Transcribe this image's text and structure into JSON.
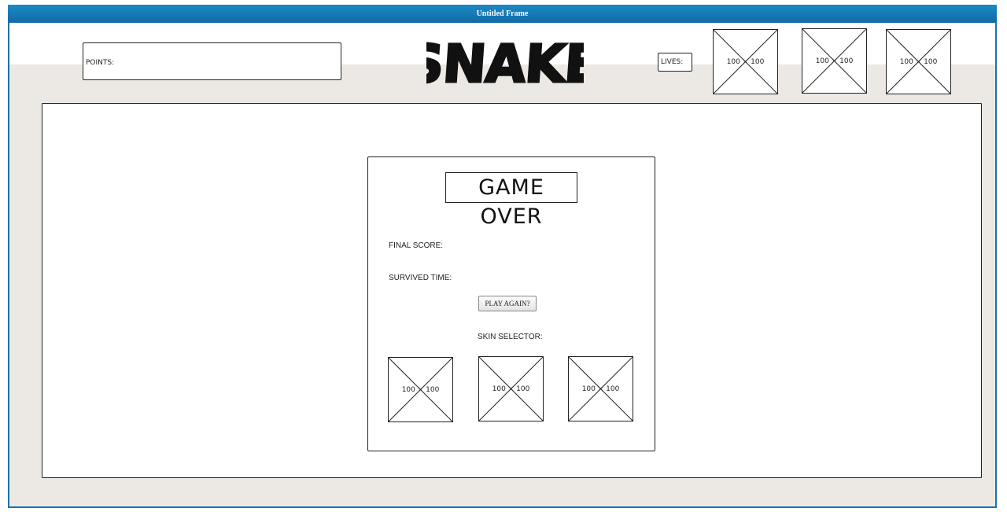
{
  "window": {
    "title": "Untitled Frame"
  },
  "header": {
    "points_label": "POINTS:",
    "logo_text": "SNAKE",
    "lives_label": "LIVES:",
    "lives_icons": [
      {
        "label": "100 × 100"
      },
      {
        "label": "100 × 100"
      },
      {
        "label": "100 × 100"
      }
    ]
  },
  "dialog": {
    "title": "GAME OVER",
    "final_score_label": "FINAL SCORE:",
    "survived_time_label": "SURVIVED TIME:",
    "play_again_label": "PLAY AGAIN?",
    "skin_selector_label": "SKIN SELECTOR:",
    "skins": [
      {
        "label": "100 × 100"
      },
      {
        "label": "100 × 100"
      },
      {
        "label": "100 × 100"
      }
    ]
  },
  "colors": {
    "titlebar": "#1a8ac6",
    "frame_background": "#ece9e4",
    "ink": "#222222"
  }
}
